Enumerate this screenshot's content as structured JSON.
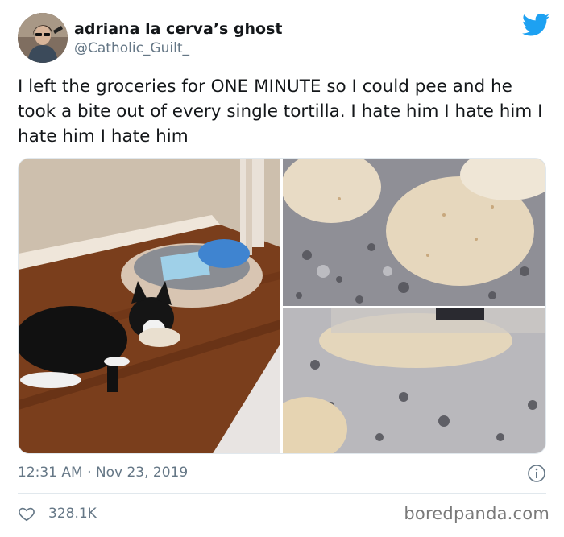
{
  "tweet": {
    "display_name": "adriana la cerva’s ghost",
    "handle": "@Catholic_Guilt_",
    "text": "I left the groceries for ONE MINUTE so I could pee and he took a bite out of every single tortilla. I hate him I hate him I hate him I hate him",
    "timestamp": "12:31 AM · Nov 23, 2019",
    "like_count": "328.1K"
  },
  "icons": {
    "brand": "twitter-bird-icon",
    "info": "info-icon",
    "like": "heart-icon"
  },
  "watermark": "boredpanda.com",
  "colors": {
    "twitter_blue": "#1da1f2",
    "text": "#14171a",
    "secondary": "#657786",
    "divider": "#e1e8ed"
  }
}
